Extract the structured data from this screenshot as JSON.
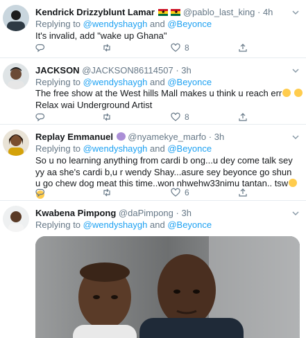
{
  "tweets": [
    {
      "name": "Kendrick Drizzyblunt Lamar",
      "handle": "@pablo_last_king",
      "time": "4h",
      "replying_prefix": "Replying to",
      "mention1": "@wendyshaygh",
      "and": "and",
      "mention2": "@Beyonce",
      "text": "It's invalid, add \"wake up Ghana\"",
      "likes": "8",
      "avatar_icon": "user-avatar"
    },
    {
      "name": "JACKSON",
      "handle": "@JACKSON86114507",
      "time": "3h",
      "replying_prefix": "Replying to",
      "mention1": "@wendyshaygh",
      "and": "and",
      "mention2": "@Beyonce",
      "text_line1": "The free show at the West hills Mall makes u think u reach err",
      "text_line2": "Relax wai Underground Artist",
      "likes": "8",
      "avatar_icon": "user-avatar"
    },
    {
      "name": "Replay Emmanuel",
      "handle": "@nyamekye_marfo",
      "time": "3h",
      "replying_prefix": "Replying to",
      "mention1": "@wendyshaygh",
      "and": "and",
      "mention2": "@Beyonce",
      "text": "So u no learning  anything from cardi b ong...u dey come talk sey yy aa she's cardi b,u r wendy Shay...asure sey beyonce go shun u go chew dog meat this time..won nhwehw33nimu tantan.. tsw",
      "likes": "6",
      "avatar_icon": "user-avatar"
    },
    {
      "name": "Kwabena Pimpong",
      "handle": "@daPimpong",
      "time": "3h",
      "replying_prefix": "Replying to",
      "mention1": "@wendyshaygh",
      "and": "and",
      "mention2": "@Beyonce",
      "avatar_icon": "user-avatar"
    }
  ],
  "dot": "·",
  "colors": {
    "link": "#1da1f2",
    "secondary_text": "#657786",
    "divider": "#e6ecf0",
    "text": "#14171a"
  },
  "icons": [
    "reply-icon",
    "retweet-icon",
    "like-icon",
    "share-icon",
    "chevron-down-icon",
    "ghana-flag-icon",
    "devil-emoji",
    "grinning-emoji"
  ]
}
